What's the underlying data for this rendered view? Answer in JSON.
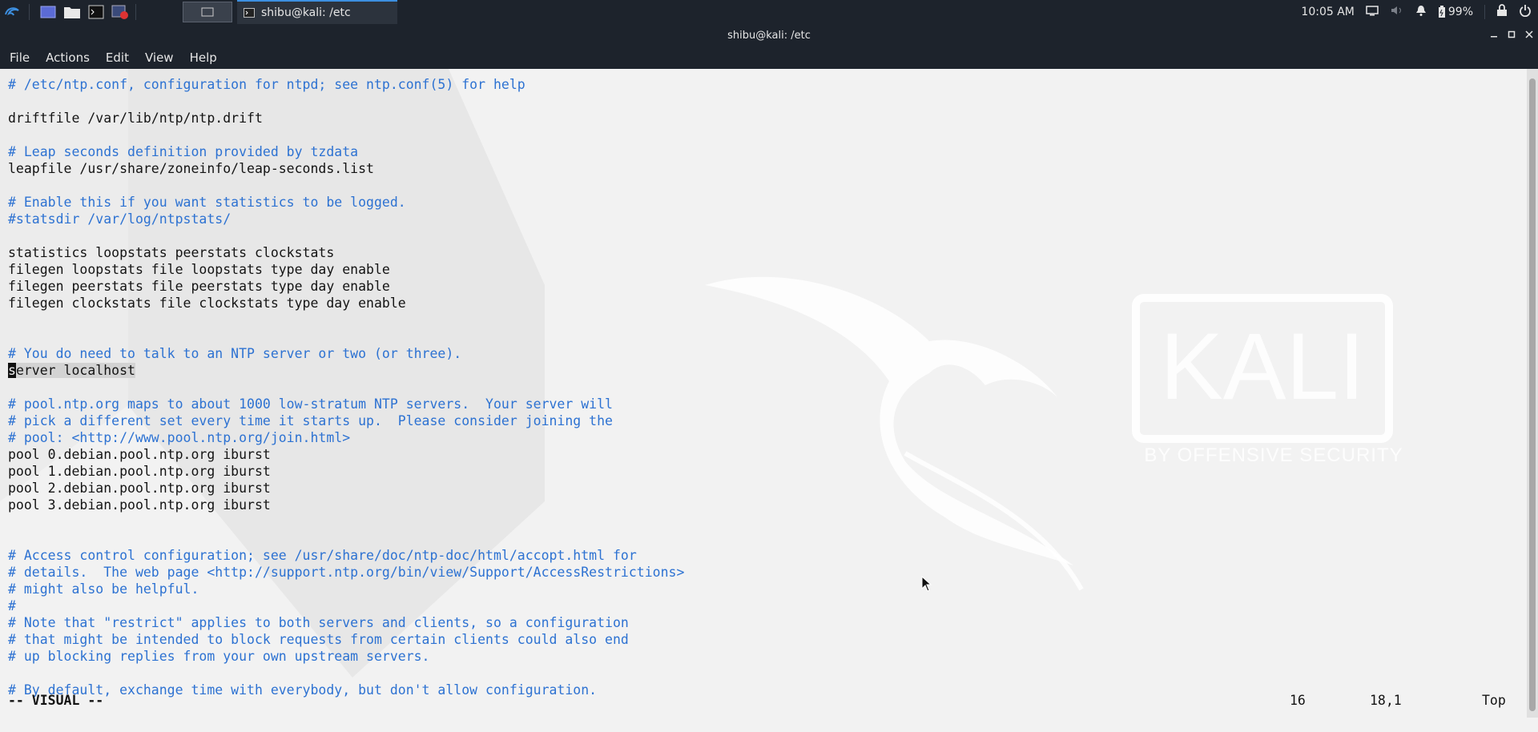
{
  "taskbar": {
    "task_title": "shibu@kali: /etc",
    "time": "10:05 AM",
    "battery": "99%"
  },
  "window": {
    "title": "shibu@kali: /etc"
  },
  "menu": [
    "File",
    "Actions",
    "Edit",
    "View",
    "Help"
  ],
  "editor": {
    "lines": [
      {
        "type": "comment",
        "text": "# /etc/ntp.conf, configuration for ntpd; see ntp.conf(5) for help"
      },
      {
        "type": "blank",
        "text": ""
      },
      {
        "type": "code",
        "text": "driftfile /var/lib/ntp/ntp.drift"
      },
      {
        "type": "blank",
        "text": ""
      },
      {
        "type": "comment",
        "text": "# Leap seconds definition provided by tzdata"
      },
      {
        "type": "code",
        "text": "leapfile /usr/share/zoneinfo/leap-seconds.list"
      },
      {
        "type": "blank",
        "text": ""
      },
      {
        "type": "comment",
        "text": "# Enable this if you want statistics to be logged."
      },
      {
        "type": "comment",
        "text": "#statsdir /var/log/ntpstats/"
      },
      {
        "type": "blank",
        "text": ""
      },
      {
        "type": "code",
        "text": "statistics loopstats peerstats clockstats"
      },
      {
        "type": "code",
        "text": "filegen loopstats file loopstats type day enable"
      },
      {
        "type": "code",
        "text": "filegen peerstats file peerstats type day enable"
      },
      {
        "type": "code",
        "text": "filegen clockstats file clockstats type day enable"
      },
      {
        "type": "blank",
        "text": ""
      },
      {
        "type": "blank",
        "text": ""
      },
      {
        "type": "comment",
        "text": "# You do need to talk to an NTP server or two (or three)."
      },
      {
        "type": "selected",
        "cursor": "s",
        "text": "erver localhost"
      },
      {
        "type": "blank",
        "text": ""
      },
      {
        "type": "comment",
        "text": "# pool.ntp.org maps to about 1000 low-stratum NTP servers.  Your server will"
      },
      {
        "type": "comment",
        "text": "# pick a different set every time it starts up.  Please consider joining the"
      },
      {
        "type": "comment",
        "text": "# pool: <http://www.pool.ntp.org/join.html>"
      },
      {
        "type": "code",
        "text": "pool 0.debian.pool.ntp.org iburst"
      },
      {
        "type": "code",
        "text": "pool 1.debian.pool.ntp.org iburst"
      },
      {
        "type": "code",
        "text": "pool 2.debian.pool.ntp.org iburst"
      },
      {
        "type": "code",
        "text": "pool 3.debian.pool.ntp.org iburst"
      },
      {
        "type": "blank",
        "text": ""
      },
      {
        "type": "blank",
        "text": ""
      },
      {
        "type": "comment",
        "text": "# Access control configuration; see /usr/share/doc/ntp-doc/html/accopt.html for"
      },
      {
        "type": "comment",
        "text": "# details.  The web page <http://support.ntp.org/bin/view/Support/AccessRestrictions>"
      },
      {
        "type": "comment",
        "text": "# might also be helpful."
      },
      {
        "type": "comment",
        "text": "#"
      },
      {
        "type": "comment",
        "text": "# Note that \"restrict\" applies to both servers and clients, so a configuration"
      },
      {
        "type": "comment",
        "text": "# that might be intended to block requests from certain clients could also end"
      },
      {
        "type": "comment",
        "text": "# up blocking replies from your own upstream servers."
      },
      {
        "type": "blank",
        "text": ""
      },
      {
        "type": "comment",
        "text": "# By default, exchange time with everybody, but don't allow configuration."
      }
    ]
  },
  "status": {
    "mode": "-- VISUAL --",
    "count": "16",
    "position": "18,1",
    "scroll": "Top"
  },
  "wallpaper": {
    "logo_text": "KALI",
    "tagline": "BY OFFENSIVE SECURITY"
  },
  "colors": {
    "comment": "#2d72d2",
    "code": "#141414",
    "bar": "#1d232c",
    "accent": "#3d8fe0"
  }
}
